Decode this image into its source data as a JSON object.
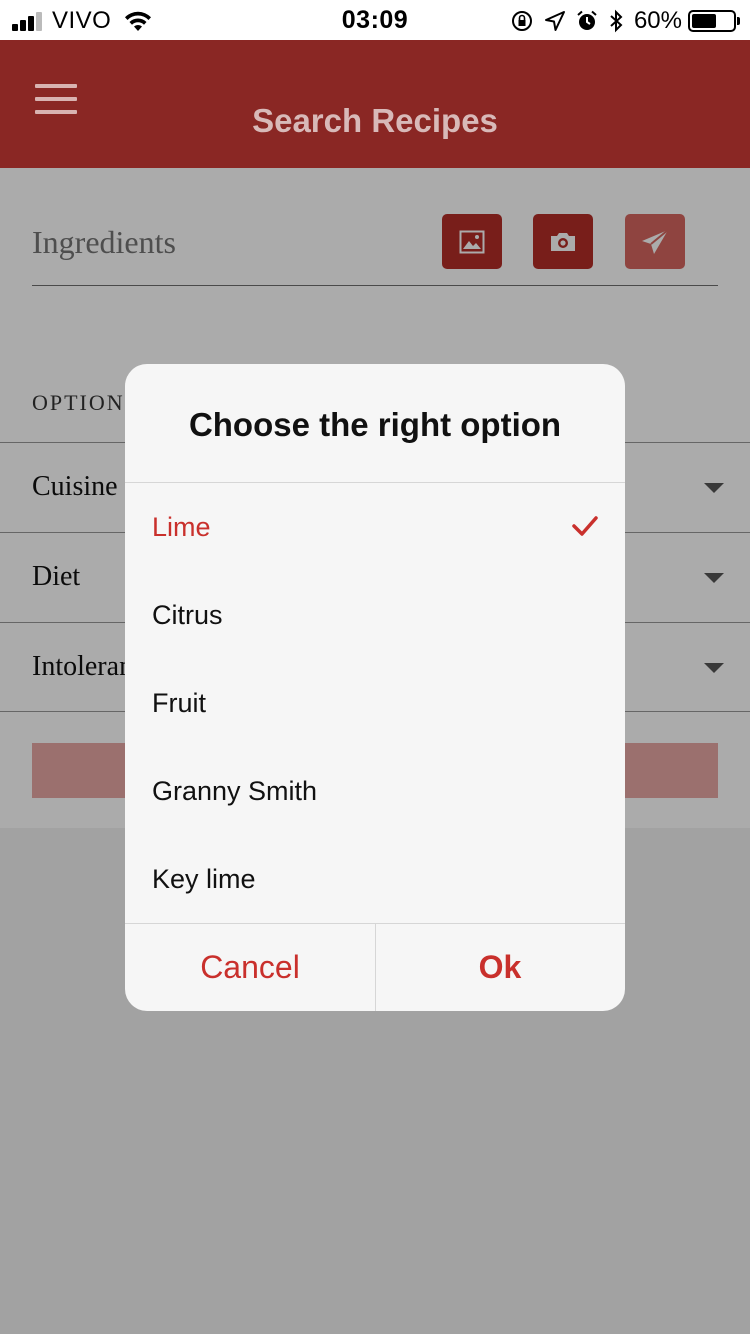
{
  "status_bar": {
    "carrier": "VIVO",
    "time": "03:09",
    "battery_percent": "60%",
    "battery_level": 0.6,
    "icons": [
      "signal-icon",
      "wifi-icon",
      "orientation-lock-icon",
      "location-icon",
      "alarm-icon",
      "bluetooth-icon",
      "battery-icon"
    ]
  },
  "app_bar": {
    "title": "Search Recipes",
    "menu_icon": "hamburger-menu-icon",
    "color": "#8a2724"
  },
  "search": {
    "placeholder": "Ingredients",
    "buttons": [
      {
        "icon": "image-icon"
      },
      {
        "icon": "camera-icon"
      },
      {
        "icon": "send-icon",
        "disabled": true
      }
    ]
  },
  "options": {
    "label": "OPTION",
    "rows": [
      {
        "label": "Cuisine"
      },
      {
        "label": "Diet"
      },
      {
        "label": "Intoleran"
      }
    ]
  },
  "dialog": {
    "title": "Choose the right option",
    "options": [
      {
        "label": "Lime",
        "selected": true
      },
      {
        "label": "Citrus",
        "selected": false
      },
      {
        "label": "Fruit",
        "selected": false
      },
      {
        "label": "Granny Smith",
        "selected": false
      },
      {
        "label": "Key lime",
        "selected": false
      }
    ],
    "cancel_label": "Cancel",
    "ok_label": "Ok",
    "accent": "#c9302c"
  }
}
